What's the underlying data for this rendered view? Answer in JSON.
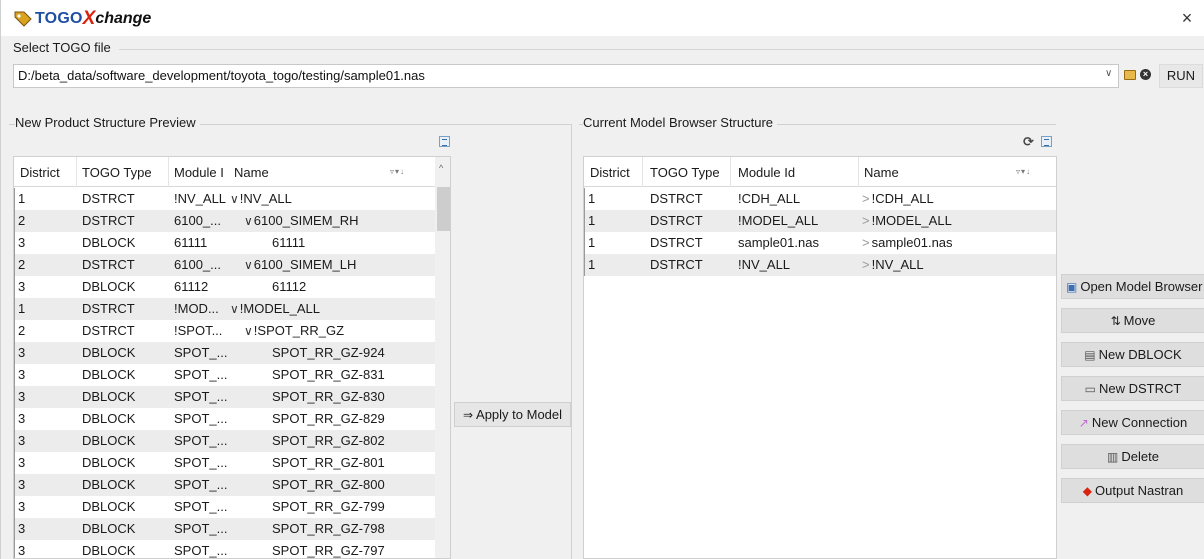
{
  "app": {
    "title_part1": "TOGO",
    "title_part2": "X",
    "title_part3": "change",
    "close": "×"
  },
  "file": {
    "label": "Select TOGO file",
    "path": "D:/beta_data/software_development/toyota_togo/testing/sample01.nas",
    "run_label": "RUN"
  },
  "left_panel": {
    "title": "New Product Structure Preview",
    "columns": [
      "District",
      "TOGO Type",
      "Module I",
      "Name"
    ],
    "rows": [
      {
        "district": "1",
        "type": "DSTRCT",
        "module": "!NV_ALL",
        "name": "!NV_ALL",
        "expand": "v",
        "indent": 0
      },
      {
        "district": "2",
        "type": "DSTRCT",
        "module": "6100_...",
        "name": "6100_SIMEM_RH",
        "expand": "v",
        "indent": 1
      },
      {
        "district": "3",
        "type": "DBLOCK",
        "module": "61111",
        "name": "61111",
        "expand": "",
        "indent": 2
      },
      {
        "district": "2",
        "type": "DSTRCT",
        "module": "6100_...",
        "name": "6100_SIMEM_LH",
        "expand": "v",
        "indent": 1
      },
      {
        "district": "3",
        "type": "DBLOCK",
        "module": "61112",
        "name": "61112",
        "expand": "",
        "indent": 2
      },
      {
        "district": "1",
        "type": "DSTRCT",
        "module": "!MOD...",
        "name": "!MODEL_ALL",
        "expand": "v",
        "indent": 0
      },
      {
        "district": "2",
        "type": "DSTRCT",
        "module": "!SPOT...",
        "name": "!SPOT_RR_GZ",
        "expand": "v",
        "indent": 1
      },
      {
        "district": "3",
        "type": "DBLOCK",
        "module": "SPOT_...",
        "name": "SPOT_RR_GZ-924",
        "expand": "",
        "indent": 2
      },
      {
        "district": "3",
        "type": "DBLOCK",
        "module": "SPOT_...",
        "name": "SPOT_RR_GZ-831",
        "expand": "",
        "indent": 2
      },
      {
        "district": "3",
        "type": "DBLOCK",
        "module": "SPOT_...",
        "name": "SPOT_RR_GZ-830",
        "expand": "",
        "indent": 2
      },
      {
        "district": "3",
        "type": "DBLOCK",
        "module": "SPOT_...",
        "name": "SPOT_RR_GZ-829",
        "expand": "",
        "indent": 2
      },
      {
        "district": "3",
        "type": "DBLOCK",
        "module": "SPOT_...",
        "name": "SPOT_RR_GZ-802",
        "expand": "",
        "indent": 2
      },
      {
        "district": "3",
        "type": "DBLOCK",
        "module": "SPOT_...",
        "name": "SPOT_RR_GZ-801",
        "expand": "",
        "indent": 2
      },
      {
        "district": "3",
        "type": "DBLOCK",
        "module": "SPOT_...",
        "name": "SPOT_RR_GZ-800",
        "expand": "",
        "indent": 2
      },
      {
        "district": "3",
        "type": "DBLOCK",
        "module": "SPOT_...",
        "name": "SPOT_RR_GZ-799",
        "expand": "",
        "indent": 2
      },
      {
        "district": "3",
        "type": "DBLOCK",
        "module": "SPOT_...",
        "name": "SPOT_RR_GZ-798",
        "expand": "",
        "indent": 2
      },
      {
        "district": "3",
        "type": "DBLOCK",
        "module": "SPOT_...",
        "name": "SPOT_RR_GZ-797",
        "expand": "",
        "indent": 2
      }
    ]
  },
  "apply_label": "Apply to Model",
  "right_panel": {
    "title": "Current Model Browser Structure",
    "columns": [
      "District",
      "TOGO Type",
      "Module Id",
      "Name"
    ],
    "rows": [
      {
        "district": "1",
        "type": "DSTRCT",
        "module": "!CDH_ALL",
        "name": "!CDH_ALL"
      },
      {
        "district": "1",
        "type": "DSTRCT",
        "module": "!MODEL_ALL",
        "name": "!MODEL_ALL"
      },
      {
        "district": "1",
        "type": "DSTRCT",
        "module": "sample01.nas",
        "name": "sample01.nas"
      },
      {
        "district": "1",
        "type": "DSTRCT",
        "module": "!NV_ALL",
        "name": "!NV_ALL"
      }
    ]
  },
  "side_buttons": [
    {
      "label": "Open Model Browser",
      "icon": "model-browser-icon"
    },
    {
      "label": "Move",
      "icon": "move-arrows-icon"
    },
    {
      "label": "New DBLOCK",
      "icon": "dblock-icon"
    },
    {
      "label": "New DSTRCT",
      "icon": "dstrct-icon"
    },
    {
      "label": "New Connection",
      "icon": "connection-icon"
    },
    {
      "label": "Delete",
      "icon": "trash-icon"
    },
    {
      "label": "Output Nastran",
      "icon": "nastran-icon"
    }
  ]
}
